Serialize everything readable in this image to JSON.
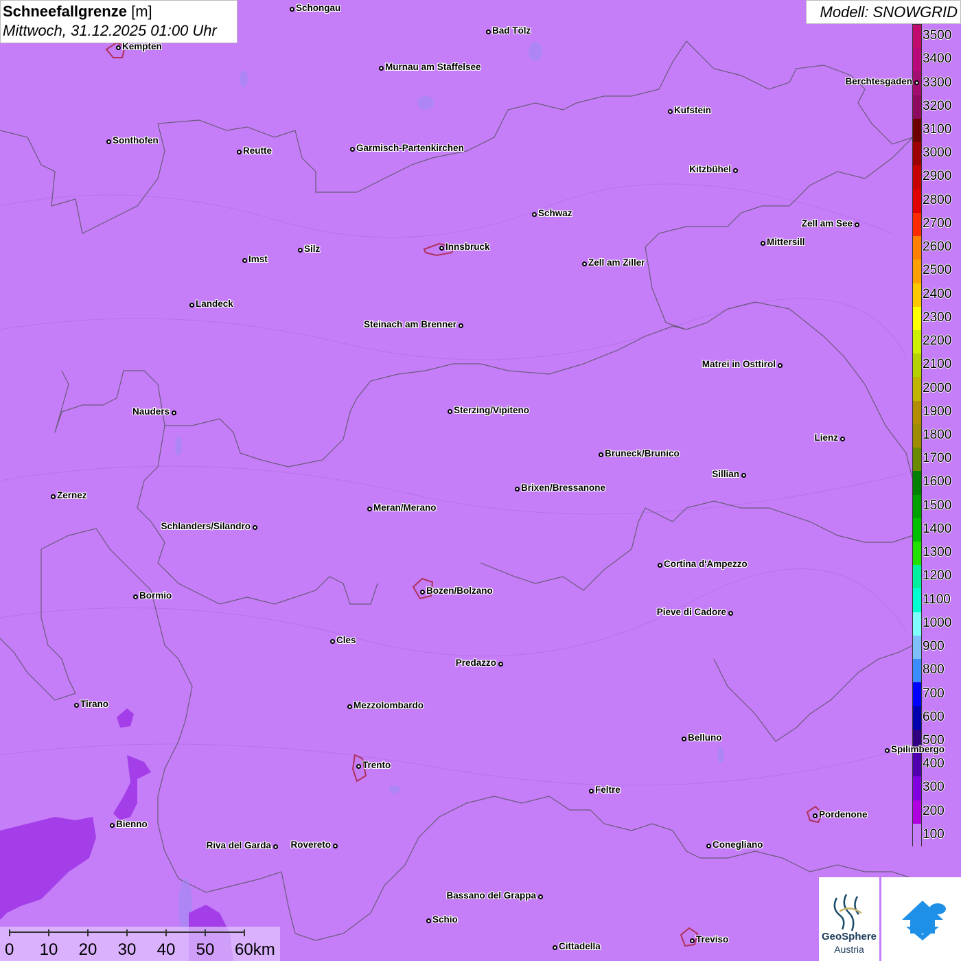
{
  "title": {
    "parameter": "Schneefallgrenze",
    "unit": "[m]",
    "datetime": "Mittwoch, 31.12.2025 01:00 Uhr"
  },
  "model": "Modell: SNOWGRID",
  "legend": {
    "labels": [
      "3500",
      "3400",
      "3300",
      "3200",
      "3100",
      "3000",
      "2900",
      "2800",
      "2700",
      "2600",
      "2500",
      "2400",
      "2300",
      "2200",
      "2100",
      "2000",
      "1900",
      "1800",
      "1700",
      "1600",
      "1500",
      "1400",
      "1300",
      "1200",
      "1100",
      "1000",
      "900",
      "800",
      "700",
      "600",
      "500",
      "400",
      "300",
      "200",
      "100"
    ],
    "colors": [
      "#c20a6e",
      "#b8087a",
      "#a30d6f",
      "#8d0a5e",
      "#6e0000",
      "#9e0000",
      "#c80000",
      "#e00000",
      "#ff2a00",
      "#ff7f00",
      "#ffa000",
      "#ffc800",
      "#ffff00",
      "#ccf000",
      "#b4d200",
      "#c0b400",
      "#b48c00",
      "#a08c00",
      "#6a8a00",
      "#008000",
      "#00a000",
      "#00c000",
      "#22e000",
      "#00f0a0",
      "#00ffd0",
      "#80ffff",
      "#80c0ff",
      "#3a8cff",
      "#0000ff",
      "#0000b0",
      "#300080",
      "#5000b0",
      "#8000e0",
      "#b000e0",
      "#c57ef8"
    ]
  },
  "cities": [
    {
      "name": "Schongau",
      "label_side": "right"
    },
    {
      "name": "Kempten",
      "label_side": "right"
    },
    {
      "name": "Bad Tölz",
      "label_side": "right"
    },
    {
      "name": "Murnau am Staffelsee",
      "label_side": "right"
    },
    {
      "name": "Berchtesgaden",
      "label_side": "left"
    },
    {
      "name": "Kufstein",
      "label_side": "right"
    },
    {
      "name": "Sonthofen",
      "label_side": "right"
    },
    {
      "name": "Reutte",
      "label_side": "right"
    },
    {
      "name": "Garmisch-Partenkirchen",
      "label_side": "right"
    },
    {
      "name": "Kitzbühel",
      "label_side": "left"
    },
    {
      "name": "Schwaz",
      "label_side": "right"
    },
    {
      "name": "Zell am See",
      "label_side": "left"
    },
    {
      "name": "Mittersill",
      "label_side": "right"
    },
    {
      "name": "Innsbruck",
      "label_side": "right"
    },
    {
      "name": "Silz",
      "label_side": "right"
    },
    {
      "name": "Imst",
      "label_side": "right"
    },
    {
      "name": "Zell am Ziller",
      "label_side": "right"
    },
    {
      "name": "Landeck",
      "label_side": "right"
    },
    {
      "name": "Steinach am Brenner",
      "label_side": "left"
    },
    {
      "name": "Matrei in Osttirol",
      "label_side": "left"
    },
    {
      "name": "Nauders",
      "label_side": "left"
    },
    {
      "name": "Sterzing/Vipiteno",
      "label_side": "right"
    },
    {
      "name": "Lienz",
      "label_side": "left"
    },
    {
      "name": "Bruneck/Brunico",
      "label_side": "right"
    },
    {
      "name": "Sillian",
      "label_side": "left"
    },
    {
      "name": "Zernez",
      "label_side": "right"
    },
    {
      "name": "Brixen/Bressanone",
      "label_side": "right"
    },
    {
      "name": "Meran/Merano",
      "label_side": "right"
    },
    {
      "name": "Schlanders/Silandro",
      "label_side": "left"
    },
    {
      "name": "Cortina d'Ampezzo",
      "label_side": "right"
    },
    {
      "name": "Bormio",
      "label_side": "right"
    },
    {
      "name": "Bozen/Bolzano",
      "label_side": "right"
    },
    {
      "name": "Pieve di Cadore",
      "label_side": "left"
    },
    {
      "name": "Cles",
      "label_side": "right"
    },
    {
      "name": "Predazzo",
      "label_side": "left"
    },
    {
      "name": "Tirano",
      "label_side": "right"
    },
    {
      "name": "Mezzolombardo",
      "label_side": "right"
    },
    {
      "name": "Belluno",
      "label_side": "right"
    },
    {
      "name": "Spilimbergo",
      "label_side": "right"
    },
    {
      "name": "Trento",
      "label_side": "right"
    },
    {
      "name": "Feltre",
      "label_side": "right"
    },
    {
      "name": "Pordenone",
      "label_side": "right"
    },
    {
      "name": "Bienno",
      "label_side": "right"
    },
    {
      "name": "Riva del Garda",
      "label_side": "left"
    },
    {
      "name": "Rovereto",
      "label_side": "left"
    },
    {
      "name": "Conegliano",
      "label_side": "right"
    },
    {
      "name": "Bassano del Grappa",
      "label_side": "left"
    },
    {
      "name": "Schio",
      "label_side": "right"
    },
    {
      "name": "Cittadella",
      "label_side": "right"
    },
    {
      "name": "Treviso",
      "label_side": "right"
    }
  ],
  "scale_bar": {
    "ticks": [
      "0",
      "10",
      "20",
      "30",
      "40",
      "50",
      "60km"
    ]
  },
  "logos": {
    "geosphere_line1": "GeoSphere",
    "geosphere_line2": "Austria"
  }
}
